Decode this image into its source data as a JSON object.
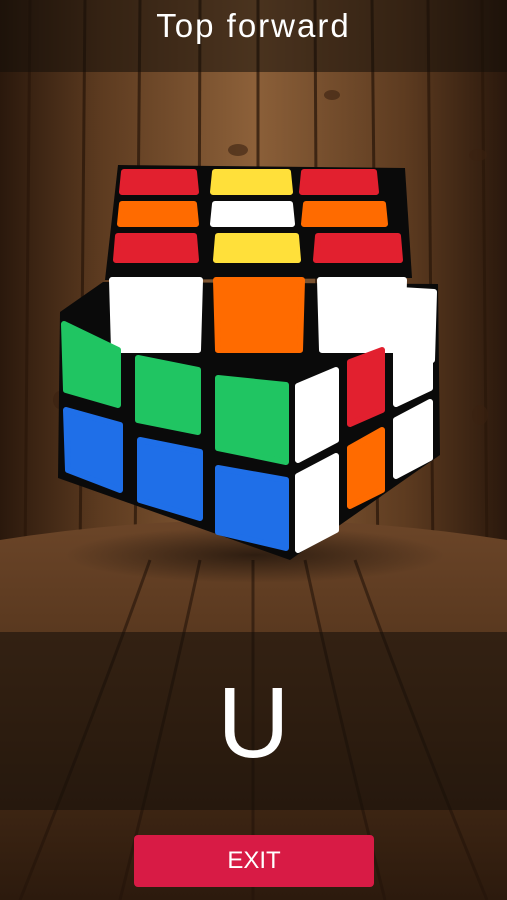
{
  "header": {
    "title": "Top forward"
  },
  "move": {
    "notation": "U"
  },
  "actions": {
    "exit_label": "EXIT"
  },
  "colors": {
    "red": "#e2202f",
    "orange": "#ff6b00",
    "yellow": "#ffe03a",
    "white": "#ffffff",
    "green": "#20c562",
    "blue": "#1f6fe8",
    "exit": "#d81b45"
  },
  "cube": {
    "top_face": [
      [
        "red",
        "yellow",
        "red"
      ],
      [
        "orange",
        "white",
        "orange"
      ],
      [
        "red",
        "yellow",
        "red"
      ]
    ],
    "top_layer_front": [
      "white",
      "orange",
      "white"
    ],
    "top_layer_right": [
      "white",
      "white"
    ],
    "front_face": [
      [
        "green",
        "green",
        "green"
      ],
      [
        "blue",
        "blue",
        "blue"
      ]
    ],
    "right_face": [
      [
        "white",
        "red",
        "white"
      ],
      [
        "white",
        "orange",
        "white"
      ]
    ]
  }
}
